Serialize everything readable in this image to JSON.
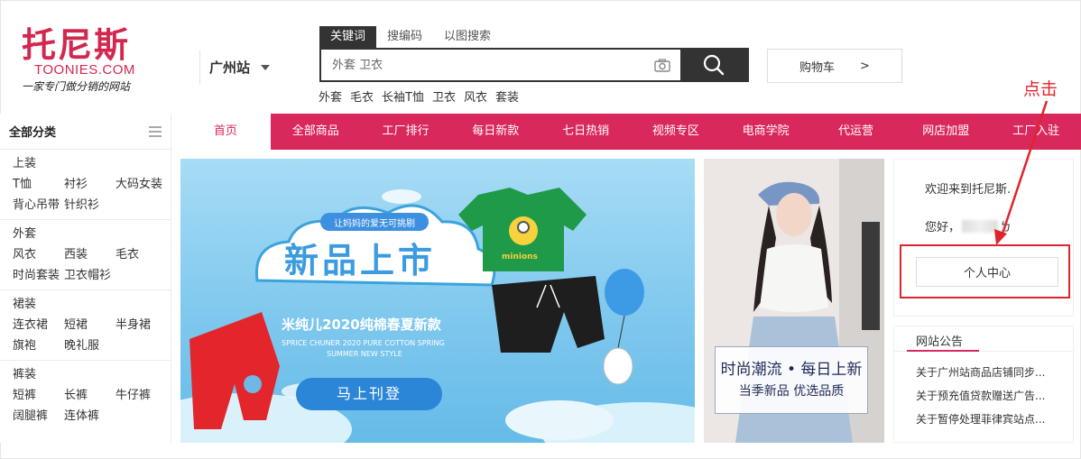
{
  "logo": {
    "cn": "托尼斯",
    "en": "TOONIES.COM",
    "tagline": "一家专门做分销的网站"
  },
  "city": {
    "label": "广州站"
  },
  "search": {
    "tabs": [
      "关键词",
      "搜编码",
      "以图搜索"
    ],
    "active_tab": 0,
    "placeholder": "外套 卫衣",
    "hot_words": [
      "外套",
      "毛衣",
      "长袖T恤",
      "卫衣",
      "风衣",
      "套装"
    ]
  },
  "cart": {
    "label": "购物车",
    "arrow": ">"
  },
  "annotation": {
    "label": "点击",
    "color": "#e0242d"
  },
  "nav": {
    "items": [
      "首页",
      "全部商品",
      "工厂排行",
      "每日新款",
      "七日热销",
      "视频专区",
      "电商学院",
      "代运营",
      "网店加盟",
      "工厂入驻"
    ],
    "active": 0,
    "color": "#d9285b"
  },
  "category": {
    "title": "全部分类",
    "groups": [
      {
        "title": "上装",
        "links": [
          "T恤",
          "衬衫",
          "大码女装",
          "背心吊带",
          "针织衫"
        ]
      },
      {
        "title": "外套",
        "links": [
          "风衣",
          "西装",
          "毛衣",
          "时尚套装",
          "卫衣帽衫"
        ]
      },
      {
        "title": "裙装",
        "links": [
          "连衣裙",
          "短裙",
          "半身裙",
          "旗袍",
          "晚礼服"
        ]
      },
      {
        "title": "裤装",
        "links": [
          "短裤",
          "长裤",
          "牛仔裤",
          "阔腿裤",
          "连体裤"
        ]
      }
    ]
  },
  "banner": {
    "ribbon": "让妈妈的爱无可挑剔",
    "headline": "新品上市",
    "subtitle": "米纯儿2020纯棉春夏新款",
    "en_line1": "SPRICE CHUNER 2020 PURE COTTON SPRING",
    "en_line2": "SUMMER NEW STYLE",
    "cta": "马上刊登",
    "shirt_text": "minions"
  },
  "side_photo": {
    "line1": "时尚潮流 • 每日上新",
    "line2": "当季新品 优选品质"
  },
  "user_panel": {
    "welcome": "欢迎来到托尼斯.",
    "hello_prefix": "您好，",
    "hello_suffix": "ㄅ",
    "center_button": "个人中心"
  },
  "notice": {
    "tab": "网站公告",
    "items": [
      "关于广州站商品店铺同步...",
      "关于预充值贷款赠送广告...",
      "关于暂停处理菲律宾站点..."
    ]
  }
}
